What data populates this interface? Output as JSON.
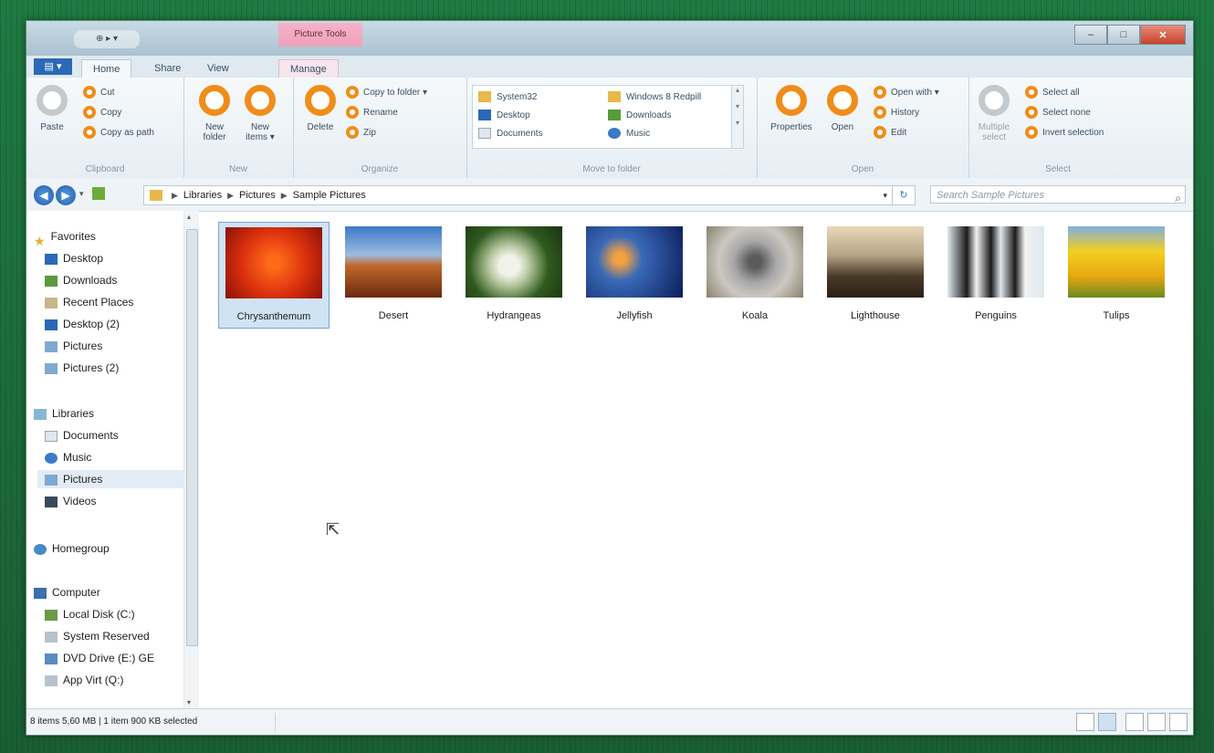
{
  "window": {
    "quick_access": "⊕ ▸ ▾",
    "context_tab_group": "Picture Tools",
    "controls": {
      "minimize": "–",
      "maximize": "□",
      "close": "✕"
    }
  },
  "tabs": {
    "file": "▤ ▾",
    "home": "Home",
    "share": "Share",
    "view": "View",
    "manage": "Manage"
  },
  "ribbon": {
    "clipboard": {
      "label": "Clipboard",
      "paste": "Paste",
      "cut": "Cut",
      "copy": "Copy",
      "copy_as_path": "Copy as path"
    },
    "new": {
      "label": "New",
      "new_folder": "New folder",
      "new_items": "New items ▾"
    },
    "organize": {
      "label": "Organize",
      "delete": "Delete",
      "copy_to_folder": "Copy to folder ▾",
      "rename": "Rename",
      "zip": "Zip"
    },
    "move_to_folder": {
      "label": "Move to folder",
      "items": [
        "System32",
        "Desktop",
        "Documents",
        "Windows 8 Redpill",
        "Downloads",
        "Music"
      ]
    },
    "open": {
      "label": "Open",
      "properties": "Properties",
      "open": "Open",
      "open_with": "Open with ▾",
      "history": "History",
      "edit": "Edit"
    },
    "select": {
      "label": "Select",
      "multiple_select": "Multiple select",
      "select_all": "Select all",
      "select_none": "Select none",
      "invert_selection": "Invert selection"
    }
  },
  "address": {
    "crumbs": [
      "Libraries",
      "Pictures",
      "Sample Pictures"
    ],
    "search_placeholder": "Search Sample Pictures"
  },
  "nav": {
    "favorites": "Favorites",
    "favorites_items": [
      "Desktop",
      "Downloads",
      "Recent Places",
      "Desktop (2)",
      "Pictures",
      "Pictures (2)"
    ],
    "libraries": "Libraries",
    "libraries_items": [
      "Documents",
      "Music",
      "Pictures",
      "Videos"
    ],
    "homegroup": "Homegroup",
    "computer": "Computer",
    "computer_items": [
      "Local Disk (C:)",
      "System Reserved",
      "DVD Drive (E:) GE",
      "App Virt (Q:)"
    ]
  },
  "files": [
    "Chrysanthemum",
    "Desert",
    "Hydrangeas",
    "Jellyfish",
    "Koala",
    "Lighthouse",
    "Penguins",
    "Tulips"
  ],
  "status": {
    "text": "8 items 5,60 MB  |  1 item 900 KB selected"
  }
}
